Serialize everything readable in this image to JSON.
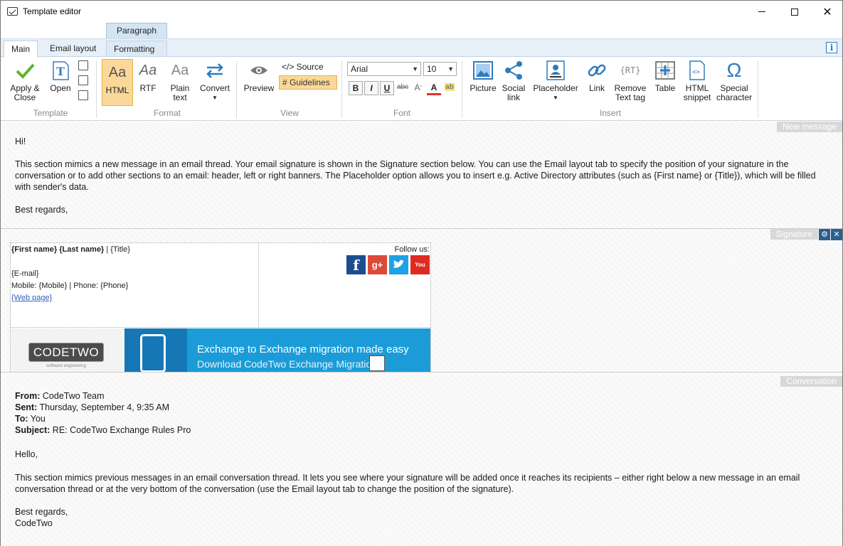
{
  "window": {
    "title": "Template editor"
  },
  "tabs": {
    "context_group": "Paragraph",
    "main": "Main",
    "email_layout": "Email layout",
    "formatting": "Formatting"
  },
  "ribbon": {
    "template": {
      "apply_close": "Apply &\nClose",
      "open": "Open",
      "group": "Template"
    },
    "format": {
      "html": "HTML",
      "rtf": "RTF",
      "plain_text": "Plain\ntext",
      "convert": "Convert",
      "group": "Format"
    },
    "view": {
      "preview": "Preview",
      "source": "</> Source",
      "guidelines": "# Guidelines",
      "group": "View"
    },
    "font": {
      "family": "Arial",
      "size": "10",
      "bold": "B",
      "italic": "I",
      "underline": "U",
      "strike": "abc",
      "group": "Font"
    },
    "insert": {
      "picture": "Picture",
      "social_link": "Social\nlink",
      "placeholder": "Placeholder",
      "link": "Link",
      "remove_text_tag": "Remove\nText tag",
      "table": "Table",
      "html_snippet": "HTML\nsnippet",
      "special_character": "Special\ncharacter",
      "group": "Insert"
    }
  },
  "sections": {
    "new_message": "New message",
    "signature": "Signature",
    "conversation": "Conversation"
  },
  "new_message": {
    "greeting": "Hi!",
    "body": "This section mimics a new message in an email thread. Your email signature is shown in the Signature section below. You can use the Email layout tab to specify the position of your signature in the conversation or to add other sections to an email: header, left or right banners. The Placeholder option allows you to insert e.g. Active Directory attributes (such as {First name} or {Title}), which will be filled with sender's data.",
    "closing": "Best regards,"
  },
  "signature": {
    "name": "{First name} {Last name}",
    "title_sep": " | {Title}",
    "email": "{E-mail}",
    "phones": "Mobile: {Mobile} | Phone: {Phone}",
    "web": "{Web page}",
    "follow": "Follow us:",
    "logo_text": "CODETWO",
    "logo_sub": "software engineering",
    "banner_line1": "Exchange to Exchange migration made easy",
    "banner_line2": "Download CodeTwo Exchange Migration"
  },
  "conversation": {
    "from_label": "From:",
    "from": " CodeTwo Team",
    "sent_label": "Sent:",
    "sent": " Thursday, September 4, 9:35 AM",
    "to_label": "To:",
    "to": " You",
    "subject_label": "Subject:",
    "subject": " RE: CodeTwo Exchange Rules Pro",
    "greeting": "Hello,",
    "body": "This section mimics previous messages in an email conversation thread. It lets you see where your signature will be added once it reaches its recipients – either right below a new message in an email conversation thread or at the very bottom of the conversation (use the Email layout tab to change the position of the signature).",
    "closing1": "Best regards,",
    "closing2": "CodeTwo"
  },
  "colors": {
    "accent": "#2f7bbf",
    "selected": "#fbd89a",
    "banner": "#1b9cd8"
  }
}
